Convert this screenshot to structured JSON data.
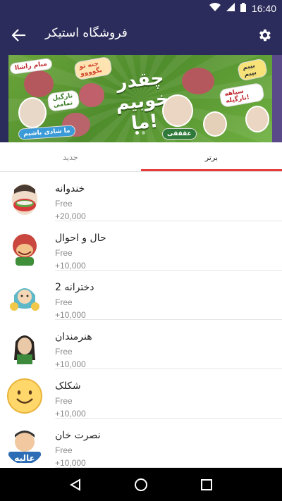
{
  "status_bar": {
    "time": "16:40"
  },
  "toolbar": {
    "title": "فروشگاه استیکر"
  },
  "banner": {
    "headline": "چقدر خوبیم ما!",
    "bubbles": [
      "مبام راشاا",
      "جنه تو بگوووو",
      "نارگیل تمامی",
      "ما شادی باشیم",
      "عقققی",
      "سیاهه نارگیله!",
      "بپیم بپیم"
    ]
  },
  "tabs": {
    "top": "برتر",
    "new": "جدید"
  },
  "packs": [
    {
      "name": "خندوانه",
      "price": "Free",
      "count": "+20,000"
    },
    {
      "name": "حال و احوال",
      "price": "Free",
      "count": "+10,000"
    },
    {
      "name": "دخترانه 2",
      "price": "Free",
      "count": "+10,000"
    },
    {
      "name": "هنرمندان",
      "price": "Free",
      "count": "+10,000"
    },
    {
      "name": "شکلک",
      "price": "Free",
      "count": "+10,000"
    },
    {
      "name": "نصرت خان",
      "price": "Free",
      "count": "+10,000"
    }
  ],
  "thumb_badge": "عالیه",
  "colors": {
    "toolbar": "#2c2c5c",
    "accent": "#e63c3c"
  }
}
